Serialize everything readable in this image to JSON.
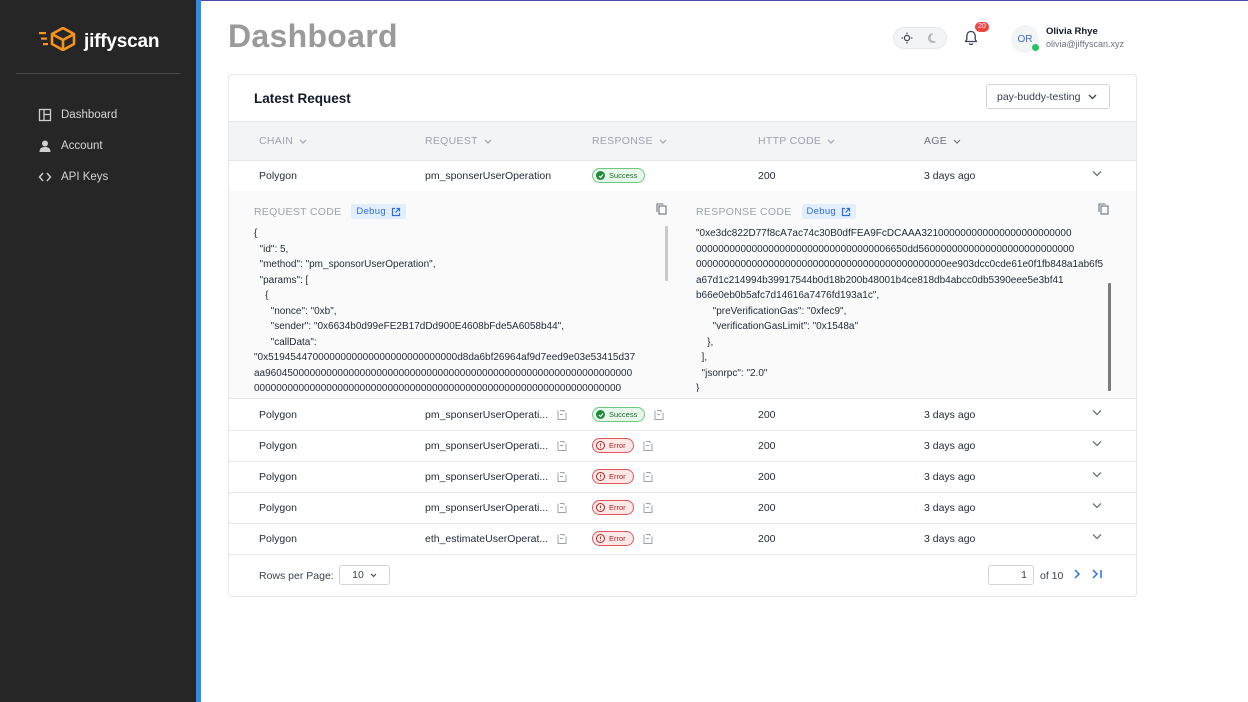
{
  "app": {
    "name": "jiffyscan"
  },
  "sidebar": {
    "items": [
      {
        "label": "Dashboard",
        "icon": "dashboard-icon"
      },
      {
        "label": "Account",
        "icon": "user-icon"
      },
      {
        "label": "API Keys",
        "icon": "code-icon"
      }
    ]
  },
  "header": {
    "title": "Dashboard",
    "notifications_count": "20",
    "user": {
      "initials": "OR",
      "name": "Olivia Rhye",
      "email": "olivia@jiffyscan.xyz"
    }
  },
  "card": {
    "title": "Latest Request",
    "selected_app": "pay-buddy-testing",
    "columns": [
      "CHAIN",
      "REQUEST",
      "RESPONSE",
      "HTTP CODE",
      "AGE"
    ],
    "rows": [
      {
        "chain": "Polygon",
        "request": "pm_sponserUserOperation",
        "response": "Success",
        "http_code": "200",
        "age": "3 days ago"
      },
      {
        "chain": "Polygon",
        "request": "pm_sponserUserOperati...",
        "response": "Success",
        "http_code": "200",
        "age": "3 days ago"
      },
      {
        "chain": "Polygon",
        "request": "pm_sponserUserOperati...",
        "response": "Error",
        "http_code": "200",
        "age": "3 days ago"
      },
      {
        "chain": "Polygon",
        "request": "pm_sponserUserOperati...",
        "response": "Error",
        "http_code": "200",
        "age": "3 days ago"
      },
      {
        "chain": "Polygon",
        "request": "pm_sponserUserOperati...",
        "response": "Error",
        "http_code": "200",
        "age": "3 days ago"
      },
      {
        "chain": "Polygon",
        "request": "eth_estimateUserOperat...",
        "response": "Error",
        "http_code": "200",
        "age": "3 days ago"
      }
    ],
    "expanded": {
      "request_label": "REQUEST CODE",
      "response_label": "RESPONSE CODE",
      "debug_label": "Debug",
      "request_code": "{\n  \"id\": 5,\n  \"method\": \"pm_sponsorUserOperation\",\n  \"params\": [\n    {\n      \"nonce\": \"0xb\",\n      \"sender\": \"0x6634b0d99eFE2B17dDd900E4608bFde5A6058b44\",\n      \"callData\":\n\"0x5194544700000000000000000000000000d8da6bf26964af9d7eed9e03e53415d37\naa960450000000000000000000000000000000000000000000000000000000000000\n000000000000000000000000000000000000000000000000000000000000000000",
      "response_code": "\"0xe3dc822D77f8cA7ac74c30B0dfFEA9FcDCAAA321000000000000000000000000\n00000000000000000000000000000000006650dd5600000000000000000000000000\n000000000000000000000000000000000000000000000ee903dcc0cde61e0f1fb848a1ab6f5\na67d1c214994b39917544b0d18b200b48001b4ce818db4abcc0db5390eee5e3bf41\nb66e0eb0b5afc7d14616a7476fd193a1c\",\n      \"preVerificationGas\": \"0xfec9\",\n      \"verificationGasLimit\": \"0x1548a\"\n    },\n  ],\n  \"jsonrpc\": \"2.0\"\n}"
    },
    "footer": {
      "rows_per_page_label": "Rows per Page:",
      "rows_per_page": "10",
      "page": "1",
      "of_label": "of 10"
    }
  },
  "colors": {
    "sidebar_bg": "#262626",
    "accent": "#2f8fe8",
    "logo": "#f7941d",
    "success": "#1c6b2c",
    "error": "#b42323"
  }
}
